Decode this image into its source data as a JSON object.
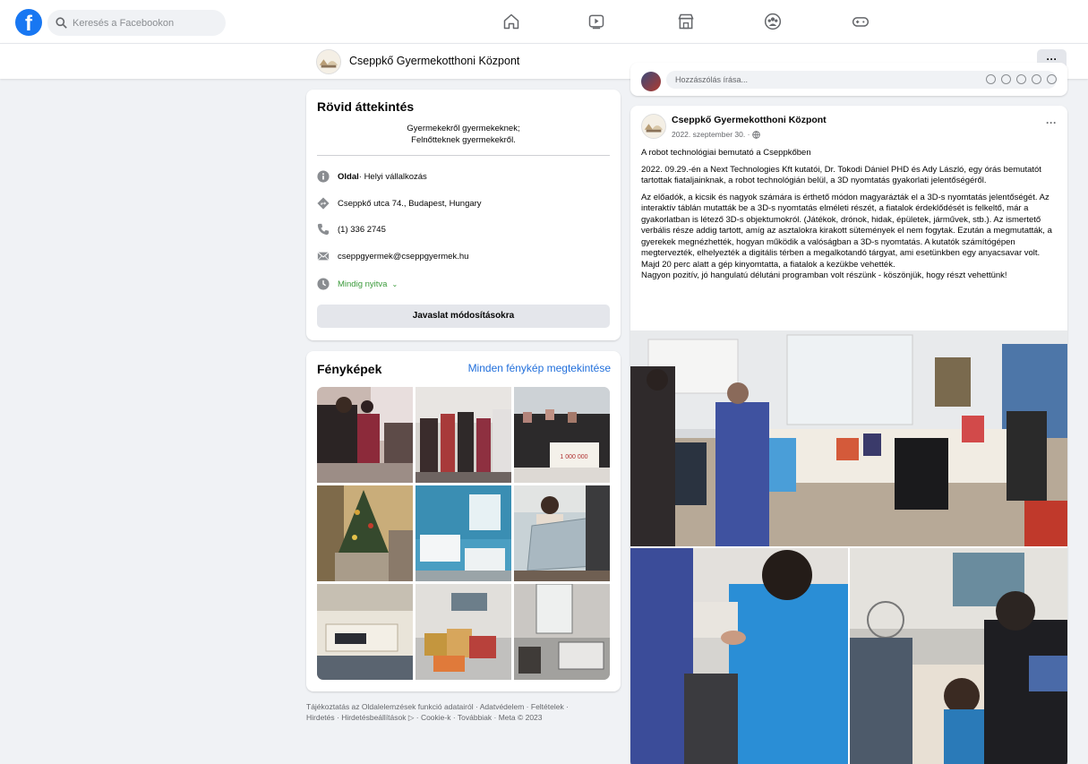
{
  "topbar": {
    "search_placeholder": "Keresés a Facebookon",
    "logo_letter": "f"
  },
  "pagebar": {
    "page_name": "Cseppkő Gyermekotthoni Központ",
    "more_label": "···"
  },
  "intro": {
    "title": "Rövid áttekintés",
    "bio_line1": "Gyermekekről gyermekeknek;",
    "bio_line2": "Felnőtteknek gyermekekről.",
    "type_label": "Oldal",
    "type_value": " · Helyi vállalkozás",
    "address": "Cseppkő utca 74., Budapest, Hungary",
    "phone": "(1) 336 2745",
    "email": "cseppgyermek@cseppgyermek.hu",
    "hours": "Mindig nyitva",
    "suggest_button": "Javaslat módosításokra"
  },
  "photos": {
    "title": "Fényképek",
    "see_all": "Minden fénykép megtekintése"
  },
  "footer": {
    "line1": "Tájékoztatás az Oldalelemzések funkció adatairól · Adatvédelem · Feltételek ·",
    "line2": "Hirdetés · Hirdetésbeállítások ▷ · Cookie-k · Továbbiak · Meta © 2023"
  },
  "prev_post": {
    "comment_placeholder": "Hozzászólás írása..."
  },
  "post": {
    "author": "Cseppkő Gyermekotthoni Központ",
    "date": "2022. szeptember 30. ·",
    "more_label": "···",
    "p1": "A robot technológiai bemutató a Cseppkőben",
    "p2": "2022. 09.29.-én a Next Technologies Kft kutatói, Dr. Tokodi Dániel PHD és Ady László, egy órás bemutatót tartottak fiataljainknak, a robot technológián belül, a 3D nyomtatás gyakorlati jelentőségéről.",
    "p3": "Az előadók, a kicsik és nagyok számára is érthető módon magyarázták el a 3D-s nyomtatás jelentőségét. Az interaktív táblán mutatták be a 3D-s nyomtatás elméleti részét, a fiatalok érdeklődését is felkeltő, már a gyakorlatban is létező 3D-s objektumokról. (Játékok, drónok, hidak, épületek, járművek, stb.). Az ismertető verbális része addig tartott, amíg az asztalokra kirakott sütemények el nem fogytak. Ezután a megmutatták, a gyerekek megnézhették, hogyan működik a valóságban a 3D-s nyomtatás. A kutatók számítógépen megtervezték, elhelyezték a digitális térben a megalkotandó tárgyat, ami esetünkben egy anyacsavar volt. Majd 20 perc alatt a gép kinyomtatta, a fiatalok a kezükbe vehették.",
    "p4": "Nagyon pozitív, jó hangulatú délutáni programban volt részünk - köszönjük, hogy részt vehettünk!"
  },
  "colors": {
    "accent": "#1877f2",
    "link": "#216fdb",
    "open_green": "#3a9a3a"
  }
}
